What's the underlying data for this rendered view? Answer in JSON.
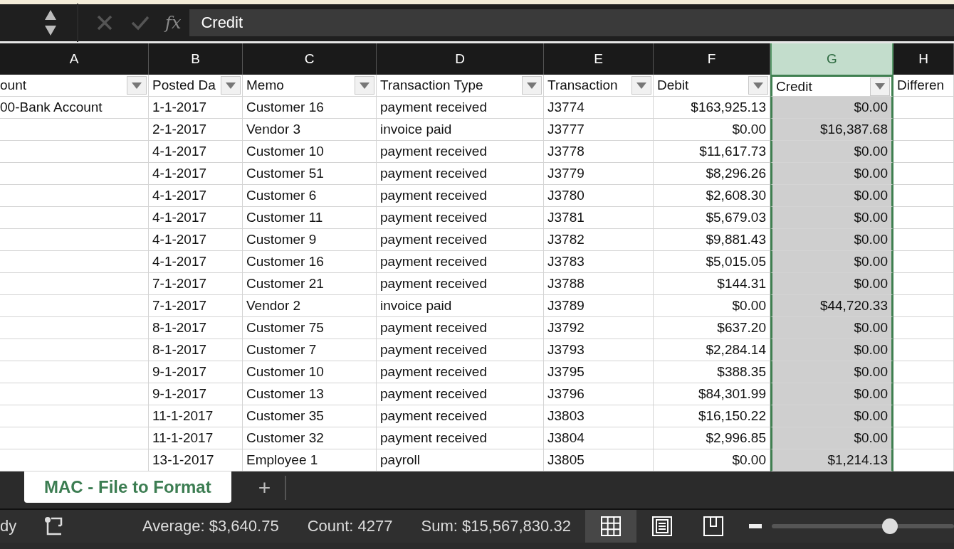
{
  "formula_bar": {
    "fx": "fx",
    "value": "Credit"
  },
  "columns": [
    {
      "letter": "A",
      "header": "ount",
      "kind": "text",
      "selected": false
    },
    {
      "letter": "B",
      "header": "Posted Da",
      "kind": "text",
      "selected": false
    },
    {
      "letter": "C",
      "header": "Memo",
      "kind": "text",
      "selected": false
    },
    {
      "letter": "D",
      "header": "Transaction Type",
      "kind": "text",
      "selected": false
    },
    {
      "letter": "E",
      "header": "Transaction",
      "kind": "text",
      "selected": false
    },
    {
      "letter": "F",
      "header": "Debit",
      "kind": "currency",
      "selected": false
    },
    {
      "letter": "G",
      "header": "Credit",
      "kind": "currency",
      "selected": true
    },
    {
      "letter": "H",
      "header": "Differen",
      "kind": "text",
      "selected": false
    }
  ],
  "rows": [
    {
      "cells": [
        "00-Bank Account",
        "1-1-2017",
        "Customer 16",
        "payment received",
        "J3774",
        "$163,925.13",
        "$0.00",
        ""
      ]
    },
    {
      "cells": [
        "",
        "2-1-2017",
        "Vendor 3",
        "invoice paid",
        "J3777",
        "$0.00",
        "$16,387.68",
        ""
      ]
    },
    {
      "cells": [
        "",
        "4-1-2017",
        "Customer 10",
        "payment received",
        "J3778",
        "$11,617.73",
        "$0.00",
        ""
      ]
    },
    {
      "cells": [
        "",
        "4-1-2017",
        "Customer 51",
        "payment received",
        "J3779",
        "$8,296.26",
        "$0.00",
        ""
      ]
    },
    {
      "cells": [
        "",
        "4-1-2017",
        "Customer 6",
        "payment received",
        "J3780",
        "$2,608.30",
        "$0.00",
        ""
      ]
    },
    {
      "cells": [
        "",
        "4-1-2017",
        "Customer 11",
        "payment received",
        "J3781",
        "$5,679.03",
        "$0.00",
        ""
      ]
    },
    {
      "cells": [
        "",
        "4-1-2017",
        "Customer 9",
        "payment received",
        "J3782",
        "$9,881.43",
        "$0.00",
        ""
      ]
    },
    {
      "cells": [
        "",
        "4-1-2017",
        "Customer 16",
        "payment received",
        "J3783",
        "$5,015.05",
        "$0.00",
        ""
      ]
    },
    {
      "cells": [
        "",
        "7-1-2017",
        "Customer 21",
        "payment received",
        "J3788",
        "$144.31",
        "$0.00",
        ""
      ]
    },
    {
      "cells": [
        "",
        "7-1-2017",
        "Vendor 2",
        "invoice paid",
        "J3789",
        "$0.00",
        "$44,720.33",
        ""
      ]
    },
    {
      "cells": [
        "",
        "8-1-2017",
        "Customer 75",
        "payment received",
        "J3792",
        "$637.20",
        "$0.00",
        ""
      ]
    },
    {
      "cells": [
        "",
        "8-1-2017",
        "Customer 7",
        "payment received",
        "J3793",
        "$2,284.14",
        "$0.00",
        ""
      ]
    },
    {
      "cells": [
        "",
        "9-1-2017",
        "Customer 10",
        "payment received",
        "J3795",
        "$388.35",
        "$0.00",
        ""
      ]
    },
    {
      "cells": [
        "",
        "9-1-2017",
        "Customer 13",
        "payment received",
        "J3796",
        "$84,301.99",
        "$0.00",
        ""
      ]
    },
    {
      "cells": [
        "",
        "11-1-2017",
        "Customer 35",
        "payment received",
        "J3803",
        "$16,150.22",
        "$0.00",
        ""
      ]
    },
    {
      "cells": [
        "",
        "11-1-2017",
        "Customer 32",
        "payment received",
        "J3804",
        "$2,996.85",
        "$0.00",
        ""
      ]
    },
    {
      "cells": [
        "",
        "13-1-2017",
        "Employee 1",
        "payroll",
        "J3805",
        "$0.00",
        "$1,214.13",
        ""
      ]
    }
  ],
  "sheet_tabs": [
    {
      "label": "MAC - File to Format",
      "selected": true
    }
  ],
  "add_sheet": "+",
  "status_bar": {
    "mode": "dy",
    "average": "Average: $3,640.75",
    "count": "Count: 4277",
    "sum": "Sum: $15,567,830.32",
    "views": [
      {
        "kind": "normal",
        "selected": true
      },
      {
        "kind": "page-layout",
        "selected": false
      },
      {
        "kind": "page-break",
        "selected": false
      }
    ],
    "zoom": {
      "level": 0.65
    }
  }
}
